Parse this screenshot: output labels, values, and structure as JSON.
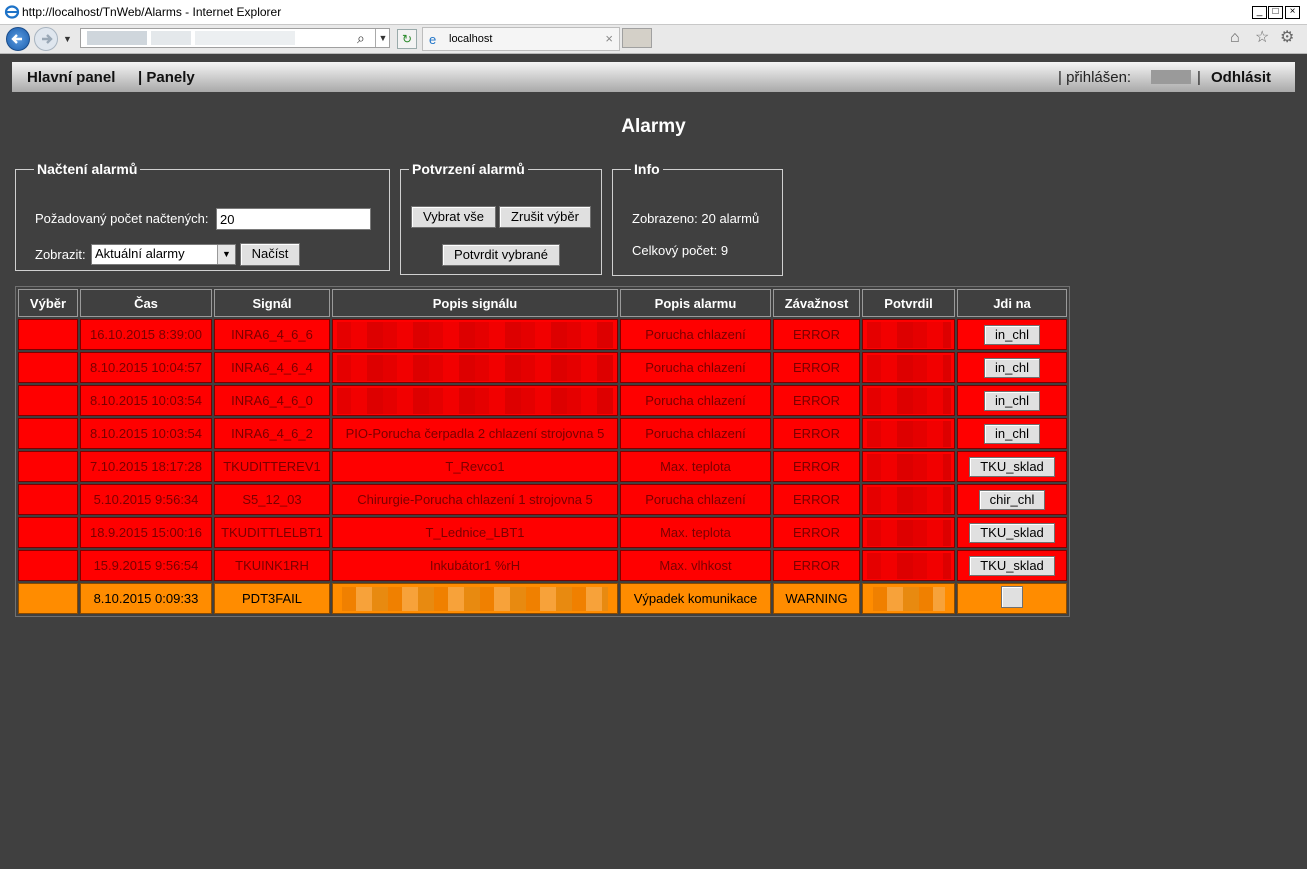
{
  "browser": {
    "title": "http://localhost/TnWeb/Alarms - Internet Explorer",
    "tab_label": "localhost",
    "close_glyph": "×"
  },
  "menu": {
    "main_panel": "Hlavní panel",
    "panels": "| Panely",
    "logged_in_prefix": "| přihlášen:",
    "separator": "|",
    "logout": "Odhlásit"
  },
  "page_title": "Alarmy",
  "load_alarms": {
    "legend": "Načtení alarmů",
    "count_label": "Požadovaný počet načtených:",
    "count_value": "20",
    "show_label": "Zobrazit:",
    "show_selected": "Aktuální alarmy",
    "load_button": "Načíst"
  },
  "confirm_alarms": {
    "legend": "Potvrzení alarmů",
    "select_all": "Vybrat vše",
    "deselect": "Zrušit výběr",
    "confirm_selected": "Potvrdit vybrané"
  },
  "info": {
    "legend": "Info",
    "shown": "Zobrazeno: 20 alarmů",
    "total": "Celkový počet: 9"
  },
  "table": {
    "headers": [
      "Výběr",
      "Čas",
      "Signál",
      "Popis signálu",
      "Popis alarmu",
      "Závažnost",
      "Potvrdil",
      "Jdi na"
    ],
    "rows": [
      {
        "time": "16.10.2015 8:39:00",
        "signal": "INRA6_4_6_6",
        "signal_desc": "",
        "alarm_desc": "Porucha chlazení",
        "severity": "ERROR",
        "goto": "in_chl"
      },
      {
        "time": "8.10.2015 10:04:57",
        "signal": "INRA6_4_6_4",
        "signal_desc": "",
        "alarm_desc": "Porucha chlazení",
        "severity": "ERROR",
        "goto": "in_chl"
      },
      {
        "time": "8.10.2015 10:03:54",
        "signal": "INRA6_4_6_0",
        "signal_desc": "",
        "alarm_desc": "Porucha chlazení",
        "severity": "ERROR",
        "goto": "in_chl"
      },
      {
        "time": "8.10.2015 10:03:54",
        "signal": "INRA6_4_6_2",
        "signal_desc": "PIO-Porucha čerpadla 2 chlazení strojovna 5",
        "alarm_desc": "Porucha chlazení",
        "severity": "ERROR",
        "goto": "in_chl"
      },
      {
        "time": "7.10.2015 18:17:28",
        "signal": "TKUDITTEREV1",
        "signal_desc": "T_Revco1",
        "alarm_desc": "Max. teplota",
        "severity": "ERROR",
        "goto": "TKU_sklad"
      },
      {
        "time": "5.10.2015 9:56:34",
        "signal": "S5_12_03",
        "signal_desc": "Chirurgie-Porucha chlazení 1 strojovna 5",
        "alarm_desc": "Porucha chlazení",
        "severity": "ERROR",
        "goto": "chir_chl"
      },
      {
        "time": "18.9.2015 15:00:16",
        "signal": "TKUDITTLELBT1",
        "signal_desc": "T_Lednice_LBT1",
        "alarm_desc": "Max. teplota",
        "severity": "ERROR",
        "goto": "TKU_sklad"
      },
      {
        "time": "15.9.2015 9:56:54",
        "signal": "TKUINK1RH",
        "signal_desc": "Inkubátor1 %rH",
        "alarm_desc": "Max. vlhkost",
        "severity": "ERROR",
        "goto": "TKU_sklad"
      },
      {
        "time": "8.10.2015 0:09:33",
        "signal": "PDT3FAIL",
        "signal_desc": "",
        "alarm_desc": "Výpadek komunikace",
        "severity": "WARNING",
        "goto": ""
      }
    ]
  },
  "colors": {
    "background": "#404040",
    "error_row": "#ff0000",
    "warning_row": "#ff8c00"
  }
}
